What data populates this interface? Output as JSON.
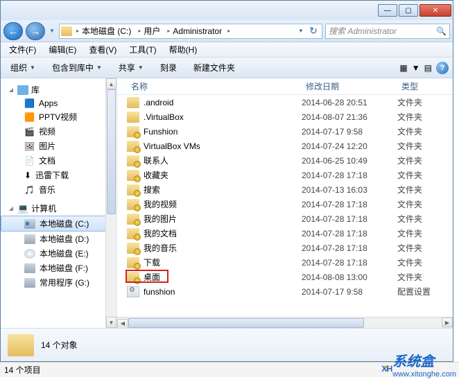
{
  "titlebar": {
    "min": "—",
    "max": "▢",
    "close": "✕"
  },
  "nav": {
    "back": "←",
    "fwd": "→",
    "drop": "▼",
    "crumbs": [
      "本地磁盘 (C:)",
      "用户",
      "Administrator"
    ],
    "sep": "▸",
    "refresh": "↻",
    "search_placeholder": "搜索 Administrator",
    "mag": "🔍"
  },
  "menu": [
    "文件(F)",
    "编辑(E)",
    "查看(V)",
    "工具(T)",
    "帮助(H)"
  ],
  "toolbar": {
    "org": "组织",
    "inc": "包含到库中",
    "share": "共享",
    "burn": "刻录",
    "newf": "新建文件夹",
    "dd": "▼",
    "view1": "▦",
    "view2": "▤",
    "help": "?"
  },
  "sidebar": {
    "lib": {
      "label": "库",
      "tw": "◢",
      "items": [
        {
          "icon": "app",
          "label": "Apps"
        },
        {
          "icon": "pptv",
          "label": "PPTV视频"
        },
        {
          "icon": "vid",
          "label": "视频"
        },
        {
          "icon": "pic",
          "label": "图片"
        },
        {
          "icon": "doc",
          "label": "文档"
        },
        {
          "icon": "dl",
          "label": "迅雷下载"
        },
        {
          "icon": "mus",
          "label": "音乐"
        }
      ]
    },
    "comp": {
      "label": "计算机",
      "tw": "◢",
      "items": [
        {
          "icon": "diskc",
          "label": "本地磁盘 (C:)",
          "sel": true
        },
        {
          "icon": "disk",
          "label": "本地磁盘 (D:)"
        },
        {
          "icon": "cd",
          "label": "本地磁盘 (E:)"
        },
        {
          "icon": "disk",
          "label": "本地磁盘 (F:)"
        },
        {
          "icon": "disk",
          "label": "常用程序 (G:)"
        }
      ]
    }
  },
  "columns": {
    "name": "名称",
    "date": "修改日期",
    "type": "类型"
  },
  "files": [
    {
      "ico": "fold",
      "name": ".android",
      "date": "2014-06-28 20:51",
      "type": "文件夹"
    },
    {
      "ico": "fold",
      "name": ".VirtualBox",
      "date": "2014-08-07 21:36",
      "type": "文件夹"
    },
    {
      "ico": "foldl",
      "name": "Funshion",
      "date": "2014-07-17 9:58",
      "type": "文件夹"
    },
    {
      "ico": "foldl",
      "name": "VirtualBox VMs",
      "date": "2014-07-24 12:20",
      "type": "文件夹"
    },
    {
      "ico": "foldl",
      "name": "联系人",
      "date": "2014-06-25 10:49",
      "type": "文件夹"
    },
    {
      "ico": "foldl",
      "name": "收藏夹",
      "date": "2014-07-28 17:18",
      "type": "文件夹"
    },
    {
      "ico": "foldl",
      "name": "搜索",
      "date": "2014-07-13 16:03",
      "type": "文件夹"
    },
    {
      "ico": "foldl",
      "name": "我的视频",
      "date": "2014-07-28 17:18",
      "type": "文件夹"
    },
    {
      "ico": "foldl",
      "name": "我的图片",
      "date": "2014-07-28 17:18",
      "type": "文件夹"
    },
    {
      "ico": "foldl",
      "name": "我的文档",
      "date": "2014-07-28 17:18",
      "type": "文件夹"
    },
    {
      "ico": "foldl",
      "name": "我的音乐",
      "date": "2014-07-28 17:18",
      "type": "文件夹"
    },
    {
      "ico": "foldl",
      "name": "下载",
      "date": "2014-07-28 17:18",
      "type": "文件夹"
    },
    {
      "ico": "foldl",
      "name": "桌面",
      "date": "2014-08-08 13:00",
      "type": "文件夹",
      "hl": true
    },
    {
      "ico": "cfg",
      "name": "funshion",
      "date": "2014-07-17 9:58",
      "type": "配置设置"
    }
  ],
  "details": {
    "count": "14 个对象"
  },
  "status": {
    "text": "14 个项目"
  },
  "watermark": {
    "brand": "系统盒",
    "url": "www.xitonghe.com"
  }
}
